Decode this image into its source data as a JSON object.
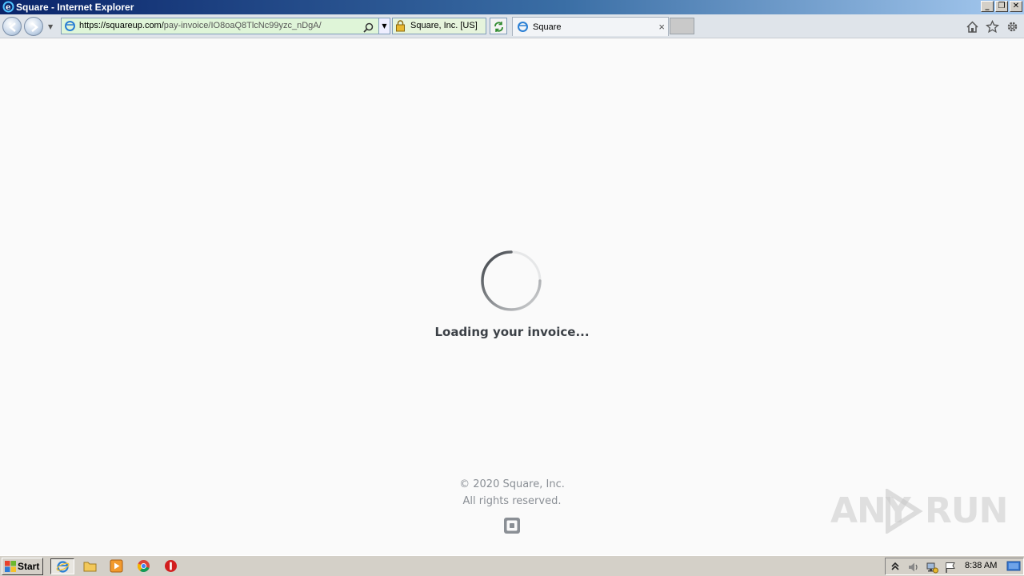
{
  "window": {
    "title": "Square - Internet Explorer",
    "buttons": {
      "minimize": "_",
      "restore": "❐",
      "close": "✕"
    }
  },
  "navbar": {
    "address": {
      "host": "https://squareup.com/",
      "path": "pay-invoice/IO8oaQ8TlcNc99yzc_nDgA/"
    },
    "certificate": "Square, Inc. [US]",
    "tab": {
      "label": "Square",
      "close": "×"
    }
  },
  "page": {
    "loading_text": "Loading your invoice...",
    "copyright_line1": "© 2020 Square, Inc.",
    "copyright_line2": "All rights reserved."
  },
  "watermark": {
    "left": "ANY",
    "right": "RUN"
  },
  "taskbar": {
    "start_label": "Start",
    "clock": "8:38 AM"
  },
  "colors": {
    "spinner": "#3c4147",
    "text": "#3c4147",
    "muted": "#8a8f95"
  }
}
